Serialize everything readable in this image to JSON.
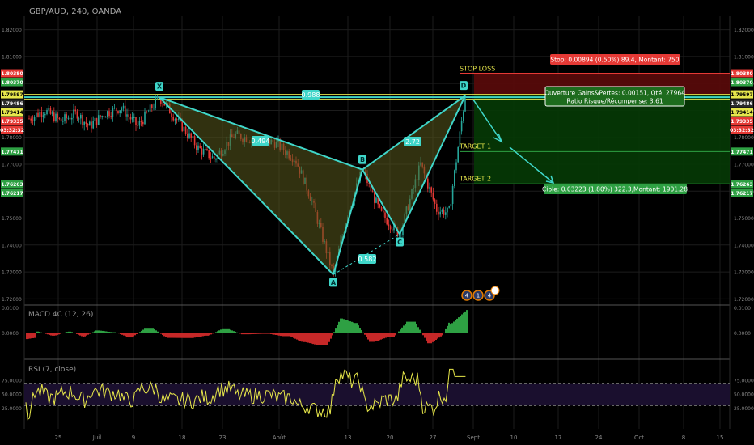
{
  "header": {
    "title": "GBP/AUD, 240, OANDA"
  },
  "colors": {
    "background": "#000000",
    "grid": "#1c1c1c",
    "candle_up": "#26a69a",
    "candle_down": "#e53935",
    "pattern_line": "#3fd6c9",
    "pattern_fill": "#5a5a1e",
    "stop_zone": "#5b0a0a",
    "profit_zone": "#063a06",
    "yellow_line": "#e6e64c",
    "macd_up": "#2ea043",
    "macd_down": "#c62828",
    "rsi_line": "#e8e84a",
    "rsi_band": "#1a0f2e"
  },
  "chart_data": {
    "type": "candlestick",
    "symbol": "GBP/AUD",
    "interval": "240",
    "price_axis_ticks": [
      "1.82000",
      "1.81000",
      "1.80000",
      "1.79000",
      "1.78000",
      "1.77000",
      "1.76000",
      "1.75000",
      "1.74000",
      "1.73000",
      "1.72000"
    ],
    "time_axis_ticks": [
      "25",
      "Juil",
      "9",
      "18",
      "23",
      "Août",
      "13",
      "20",
      "27",
      "Sept",
      "10",
      "17",
      "24",
      "Oct",
      "8",
      "15"
    ],
    "price_tags_left": [
      {
        "text": "1.80380",
        "bg": "#e53935"
      },
      {
        "text": "1.80370",
        "bg": "#2ea043"
      },
      {
        "text": "1.79597",
        "bg": "#e6e64c"
      },
      {
        "text": "1.79486",
        "bg": "#2a2a2a"
      },
      {
        "text": "1.79414",
        "bg": "#e6e64c"
      },
      {
        "text": "1.79335",
        "bg": "#e53935"
      },
      {
        "text": "03:32:32",
        "bg": "#e53935"
      },
      {
        "text": "1.77471",
        "bg": "#2ea043"
      },
      {
        "text": "1.76263",
        "bg": "#2ea043"
      },
      {
        "text": "1.76217",
        "bg": "#2ea043"
      }
    ],
    "price_tags_right": [
      {
        "text": "1.80380",
        "bg": "#e53935"
      },
      {
        "text": "1.80370",
        "bg": "#2ea043"
      },
      {
        "text": "1.79597",
        "bg": "#e6e64c"
      },
      {
        "text": "1.79486",
        "bg": "#2a2a2a"
      },
      {
        "text": "1.79414",
        "bg": "#e6e64c"
      },
      {
        "text": "1.79335",
        "bg": "#e53935"
      },
      {
        "text": "03:32:32",
        "bg": "#e53935"
      },
      {
        "text": "1.77471",
        "bg": "#2ea043"
      },
      {
        "text": "1.76263",
        "bg": "#2ea043"
      },
      {
        "text": "1.76217",
        "bg": "#2ea043"
      }
    ],
    "harmonic_pattern": {
      "points": [
        {
          "label": "X",
          "price": 1.7949
        },
        {
          "label": "A",
          "price": 1.729
        },
        {
          "label": "B",
          "price": 1.768
        },
        {
          "label": "C",
          "price": 1.744
        },
        {
          "label": "D",
          "price": 1.7955
        }
      ],
      "ratios": [
        "0.988",
        "0.494",
        "2.72",
        "0.582"
      ]
    },
    "trade": {
      "stop_loss_label": "STOP LOSS",
      "target1_label": "TARGET 1",
      "target2_label": "TARGET 2",
      "stop_box": "Stop: 0.00894 (0.50%) 89.4, Montant: 750",
      "open_box_line1": "Ouverture Gains&Pertes: 0.00151, Qté: 27964",
      "open_box_line2": "Ratio Risque/Récompense: 3.61",
      "target_box": "Cible: 0.03223 (1.80%) 322.3,Montant: 1901.28"
    },
    "macd": {
      "label": "MACD 4C (12, 26)",
      "axis_ticks": [
        "0.0100",
        "0.0000"
      ]
    },
    "rsi": {
      "label": "RSI (7, close)",
      "axis_ticks": [
        "75.0000",
        "50.0000",
        "25.0000"
      ],
      "overbought": 70,
      "oversold": 30
    },
    "event_markers": [
      "4",
      "1",
      "4"
    ]
  }
}
